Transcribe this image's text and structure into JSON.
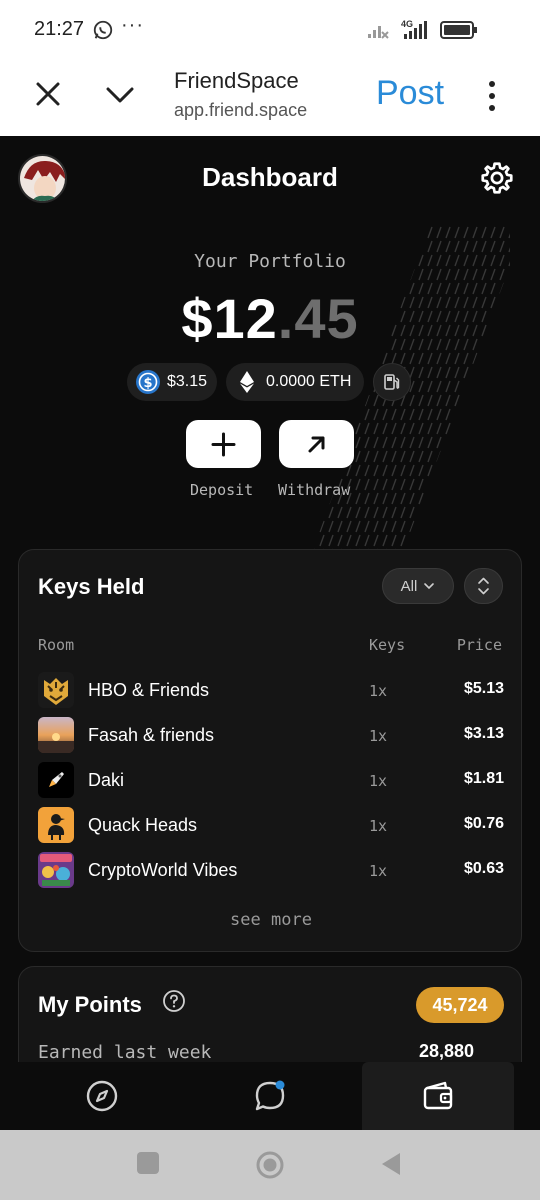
{
  "status_bar": {
    "time": "21:27",
    "dots": "···",
    "network_label": "4G"
  },
  "browser": {
    "title": "FriendSpace",
    "url": "app.friend.space",
    "post_label": "Post"
  },
  "header": {
    "title": "Dashboard"
  },
  "portfolio": {
    "label": "Your Portfolio",
    "balance_dollars": "$12",
    "balance_cents": ".45",
    "usdc_value": "$3.15",
    "eth_value": "0.0000 ETH",
    "deposit_label": "Deposit",
    "withdraw_label": "Withdraw"
  },
  "keys_held": {
    "title": "Keys Held",
    "filter_label": "All",
    "columns": {
      "room": "Room",
      "keys": "Keys",
      "price": "Price"
    },
    "rooms": [
      {
        "name": "HBO & Friends",
        "keys": "1x",
        "price": "$5.13",
        "thumb": "tiger"
      },
      {
        "name": "Fasah & friends",
        "keys": "1x",
        "price": "$3.13",
        "thumb": "sunset"
      },
      {
        "name": "Daki",
        "keys": "1x",
        "price": "$1.81",
        "thumb": "rocket"
      },
      {
        "name": "Quack Heads",
        "keys": "1x",
        "price": "$0.76",
        "thumb": "duck"
      },
      {
        "name": "CryptoWorld Vibes",
        "keys": "1x",
        "price": "$0.63",
        "thumb": "cryptoworld"
      }
    ],
    "see_more_label": "see more"
  },
  "points": {
    "title": "My Points",
    "total": "45,724",
    "earned_label": "Earned last week",
    "earned_value": "28,880"
  },
  "colors": {
    "accent_blue": "#2a8bd8",
    "points_badge": "#d99a2b",
    "background": "#0c0c0c",
    "card": "#151515"
  }
}
